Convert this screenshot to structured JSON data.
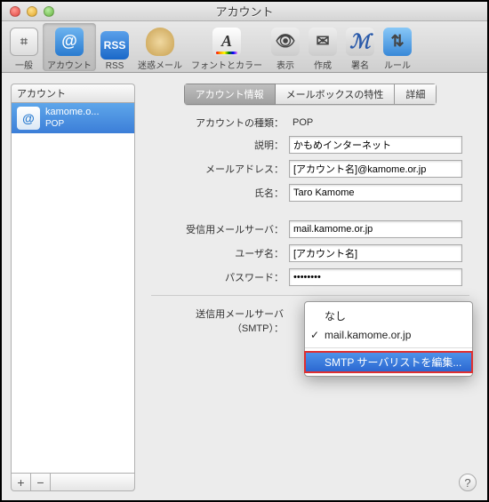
{
  "window": {
    "title": "アカウント"
  },
  "toolbar": {
    "items": [
      {
        "label": "一般"
      },
      {
        "label": "アカウント"
      },
      {
        "label": "RSS"
      },
      {
        "label": "迷惑メール"
      },
      {
        "label": "フォントとカラー"
      },
      {
        "label": "表示"
      },
      {
        "label": "作成"
      },
      {
        "label": "署名"
      },
      {
        "label": "ルール"
      }
    ]
  },
  "sidebar": {
    "header": "アカウント",
    "account": {
      "name": "kamome.o...",
      "type": "POP",
      "glyph": "@"
    },
    "add": "+",
    "remove": "−"
  },
  "tabs": {
    "info": "アカウント情報",
    "mailbox": "メールボックスの特性",
    "detail": "詳細"
  },
  "form": {
    "type_label": "アカウントの種類：",
    "type_value": "POP",
    "desc_label": "説明：",
    "desc_value": "かもめインターネット",
    "email_label": "メールアドレス：",
    "email_value": "[アカウント名]@kamome.or.jp",
    "name_label": "氏名：",
    "name_value": "Taro Kamome",
    "incoming_label": "受信用メールサーバ：",
    "incoming_value": "mail.kamome.or.jp",
    "user_label": "ユーザ名：",
    "user_value": "[アカウント名]",
    "pass_label": "パスワード：",
    "pass_value": "••••••••",
    "smtp_label": "送信用メールサーバ（SMTP）："
  },
  "smtp_menu": {
    "none": "なし",
    "server": "mail.kamome.or.jp",
    "edit": "SMTP サーバリストを編集..."
  },
  "help": "?"
}
